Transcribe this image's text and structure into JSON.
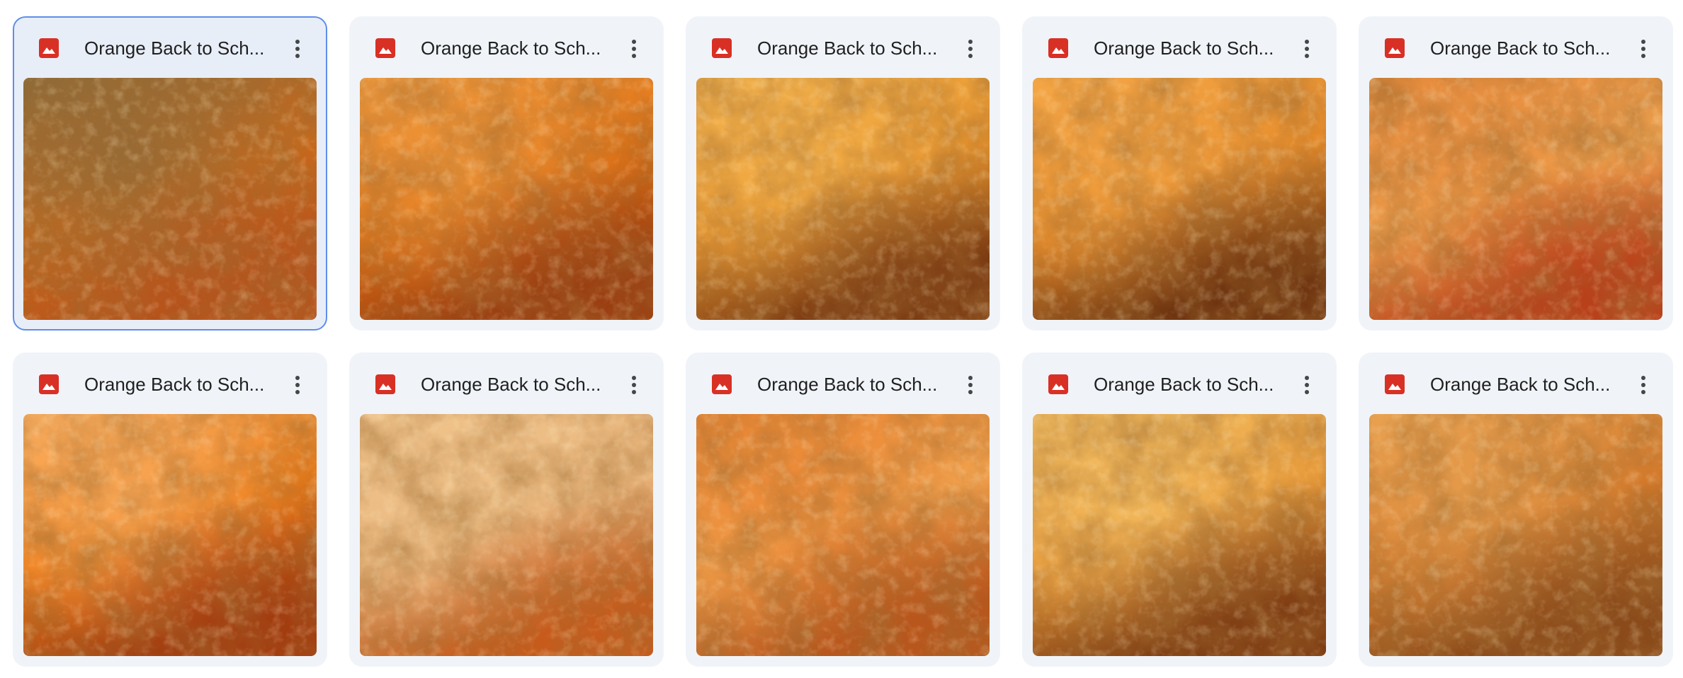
{
  "colors": {
    "card_bg": "#f0f4f9",
    "selected_border": "#5f8ee8",
    "image_icon": "#d93025",
    "title_text": "#1f1f1f"
  },
  "icons": {
    "file_type": "image-file-icon",
    "more": "more-vert-icon"
  },
  "files": [
    {
      "name": "Orange Back to Sch...",
      "selected": true,
      "palette": [
        "#c9691b",
        "#8a6a3a",
        "#b5531c"
      ]
    },
    {
      "name": "Orange Back to Sch...",
      "selected": false,
      "palette": [
        "#df7115",
        "#f09a3e",
        "#9a3d10"
      ]
    },
    {
      "name": "Orange Back to Sch...",
      "selected": false,
      "palette": [
        "#e9952d",
        "#f3b34e",
        "#7a3a12"
      ]
    },
    {
      "name": "Orange Back to Sch...",
      "selected": false,
      "palette": [
        "#e48a2a",
        "#f4a646",
        "#6f3510"
      ]
    },
    {
      "name": "Orange Back to Sch...",
      "selected": false,
      "palette": [
        "#f0a24e",
        "#e58a3c",
        "#b8401a"
      ]
    },
    {
      "name": "Orange Back to Sch...",
      "selected": false,
      "palette": [
        "#ec7b18",
        "#fbb062",
        "#a23d10"
      ]
    },
    {
      "name": "Orange Back to Sch...",
      "selected": false,
      "palette": [
        "#e7b37a",
        "#f0c48c",
        "#c65b1c"
      ]
    },
    {
      "name": "Orange Back to Sch...",
      "selected": false,
      "palette": [
        "#f0a04c",
        "#e98533",
        "#b8561c"
      ]
    },
    {
      "name": "Orange Back to Sch...",
      "selected": false,
      "palette": [
        "#e79a3a",
        "#f4bf63",
        "#7e3c12"
      ]
    },
    {
      "name": "Orange Back to Sch...",
      "selected": false,
      "palette": [
        "#d37a2c",
        "#e9a251",
        "#8a4a1a"
      ]
    }
  ]
}
